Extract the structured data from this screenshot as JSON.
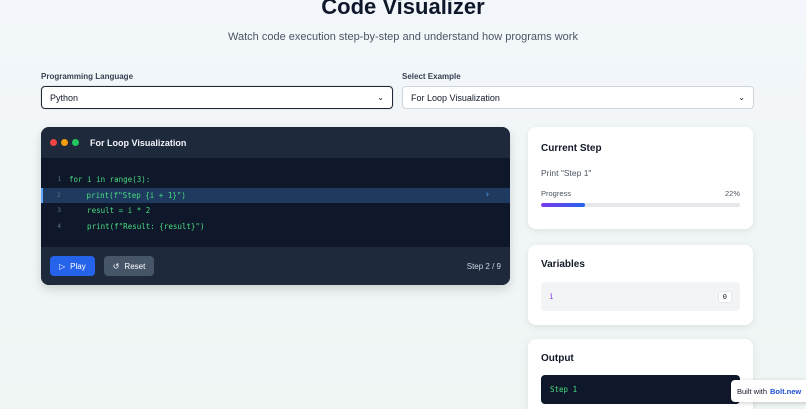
{
  "header": {
    "title": "Code Visualizer",
    "subtitle": "Watch code execution step-by-step and understand how programs work"
  },
  "controls": {
    "language_label": "Programming Language",
    "language_value": "Python",
    "example_label": "Select Example",
    "example_value": "For Loop Visualization"
  },
  "editor": {
    "title": "For Loop Visualization",
    "window_dots": [
      "#ef4444",
      "#f59e0b",
      "#22c55e"
    ],
    "lines": [
      {
        "num": "1",
        "code": "for i in range(3):"
      },
      {
        "num": "2",
        "code": "    print(f\"Step {i + 1}\")"
      },
      {
        "num": "3",
        "code": "    result = i * 2"
      },
      {
        "num": "4",
        "code": "    print(f\"Result: {result}\")"
      }
    ],
    "active_line": 2,
    "play_label": "Play",
    "reset_label": "Reset",
    "step_text": "Step 2 / 9"
  },
  "current_step": {
    "heading": "Current Step",
    "description": "Print \"Step 1\"",
    "progress_label": "Progress",
    "progress_text": "22%",
    "progress_value": 0.22
  },
  "variables": {
    "heading": "Variables",
    "items": [
      {
        "name": "i",
        "value": "0"
      }
    ]
  },
  "output": {
    "heading": "Output",
    "lines": [
      "Step 1"
    ]
  },
  "badge": {
    "prefix": "Built with",
    "brand": "Bolt.new"
  },
  "colors": {
    "accent": "#2563eb",
    "code_text": "#4ade80",
    "active_line": "#1e3a5f"
  }
}
